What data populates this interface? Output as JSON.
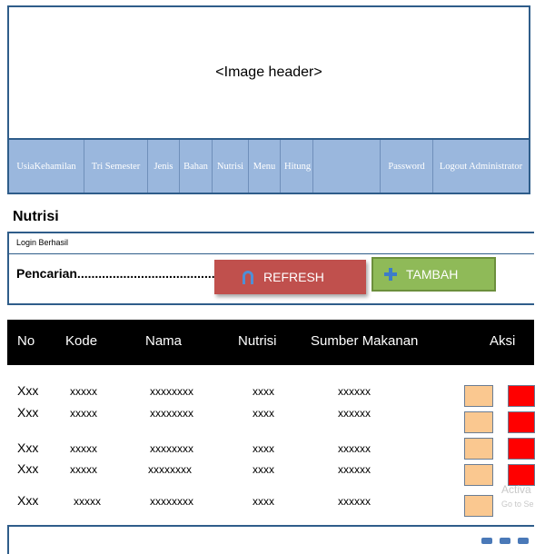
{
  "header": {
    "image_placeholder": "<Image header>"
  },
  "nav": {
    "items": [
      {
        "label": "UsiaKehamilan"
      },
      {
        "label": "Tri Semester"
      },
      {
        "label": "Jenis"
      },
      {
        "label": "Bahan"
      },
      {
        "label": "Nutrisi"
      },
      {
        "label": "Menu"
      },
      {
        "label": "Hitung"
      },
      {
        "label": "Password"
      },
      {
        "label": "Logout Administrator"
      }
    ]
  },
  "page": {
    "title": "Nutrisi"
  },
  "form": {
    "login_status": "Login Berhasil",
    "search_label": "Pencarian...........................................",
    "refresh_label": "REFRESH",
    "tambah_label": "TAMBAH"
  },
  "table": {
    "columns": [
      "No",
      "Kode",
      "Nama",
      "Nutrisi",
      "Sumber Makanan",
      "Aksi"
    ],
    "rows": [
      {
        "no": "Xxx",
        "kode": "xxxxx",
        "nama": "xxxxxxxx",
        "nutrisi": "xxxx",
        "sumber": "xxxxxx"
      },
      {
        "no": "Xxx",
        "kode": "xxxxx",
        "nama": "xxxxxxxx",
        "nutrisi": "xxxx",
        "sumber": "xxxxxx"
      },
      {
        "no": "Xxx",
        "kode": "xxxxx",
        "nama": "xxxxxxxx",
        "nutrisi": "xxxx",
        "sumber": "xxxxxx"
      },
      {
        "no": "Xxx",
        "kode": "xxxxx",
        "nama": "xxxxxxxx",
        "nutrisi": "xxxx",
        "sumber": "xxxxxx"
      },
      {
        "no": "Xxx",
        "kode": "xxxxx",
        "nama": "xxxxxxxx",
        "nutrisi": "xxxx",
        "sumber": "xxxxxx"
      }
    ]
  },
  "watermark": {
    "line1": "Activa",
    "line2": "Go to Se"
  },
  "colors": {
    "nav_bg": "#9ab7dd",
    "border": "#2f5d8a",
    "refresh_bg": "#c0504d",
    "tambah_bg": "#8fba58",
    "edit_bg": "#fac890",
    "delete_bg": "#ff0000",
    "table_head_bg": "#000000"
  },
  "icons": {
    "refresh": "arch-icon",
    "tambah": "plus-icon"
  }
}
